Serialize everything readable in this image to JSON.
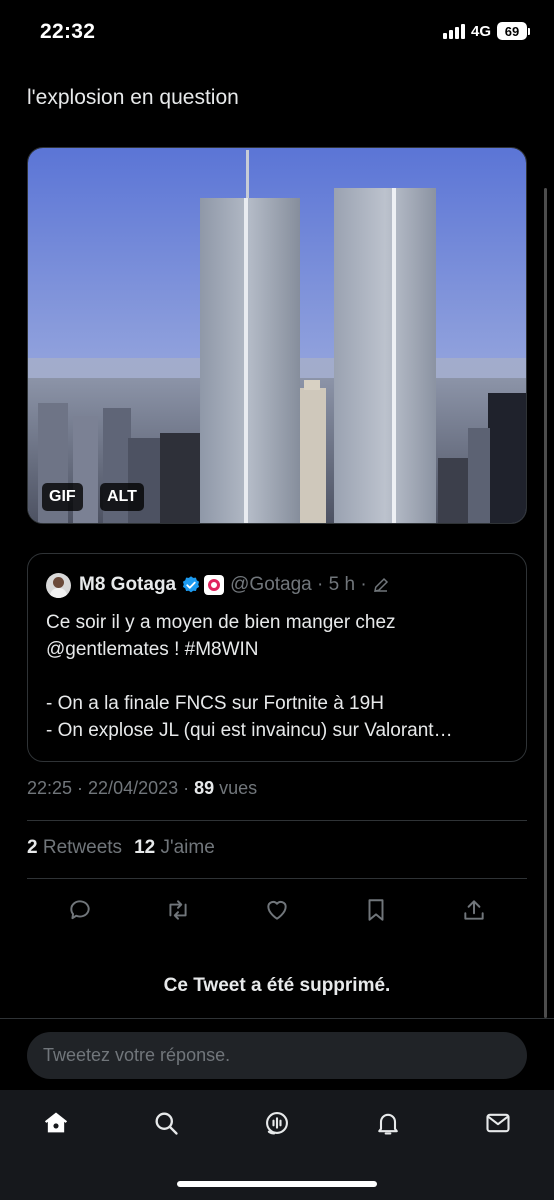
{
  "status_bar": {
    "time": "22:32",
    "network": "4G",
    "battery": "69"
  },
  "tweet": {
    "text": "l'explosion en question",
    "media": {
      "badges": [
        "GIF",
        "ALT"
      ]
    }
  },
  "quote": {
    "name": "M8 Gotaga",
    "handle": "@Gotaga · 5 h ·",
    "body": "Ce soir il y a moyen de bien manger chez @gentlemates ! #M8WIN\n\n- On a la finale FNCS sur Fortnite à 19H\n- On explose JL (qui est invaincu) sur Valorant…"
  },
  "meta": {
    "datetime": "22:25 · 22/04/2023 · ",
    "views_count": "89",
    "views_label": " vues"
  },
  "stats": {
    "retweets_count": "2",
    "retweets_label": " Retweets",
    "likes_count": "12",
    "likes_label": " J'aime"
  },
  "deleted_notice": "Ce Tweet a été supprimé.",
  "reply": {
    "placeholder": "Tweetez votre réponse."
  },
  "icons": {
    "actions": [
      "reply-icon",
      "retweet-icon",
      "like-icon",
      "bookmark-icon",
      "share-icon"
    ],
    "nav": [
      "home-icon",
      "search-icon",
      "spaces-icon",
      "notifications-icon",
      "messages-icon"
    ]
  },
  "colors": {
    "background": "#000000",
    "text": "#e7e9ea",
    "secondary_text": "#71767b",
    "border": "#2f3336",
    "verified": "#1d9bf0"
  }
}
